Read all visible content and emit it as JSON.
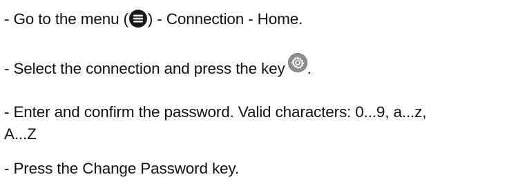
{
  "instructions": {
    "step1": {
      "before_icon": "- Go to the menu (",
      "icon": "menu-hamburger-icon",
      "after_icon": ") - Connection - Home."
    },
    "step2": {
      "before_icon": "- Select the connection and press the key",
      "icon": "gear-settings-icon",
      "after_icon": "."
    },
    "step3": {
      "line1": "- Enter and confirm the password. Valid characters: 0...9, a...z,",
      "line2": "A...Z"
    },
    "step4": {
      "text": "- Press the Change Password key."
    }
  }
}
